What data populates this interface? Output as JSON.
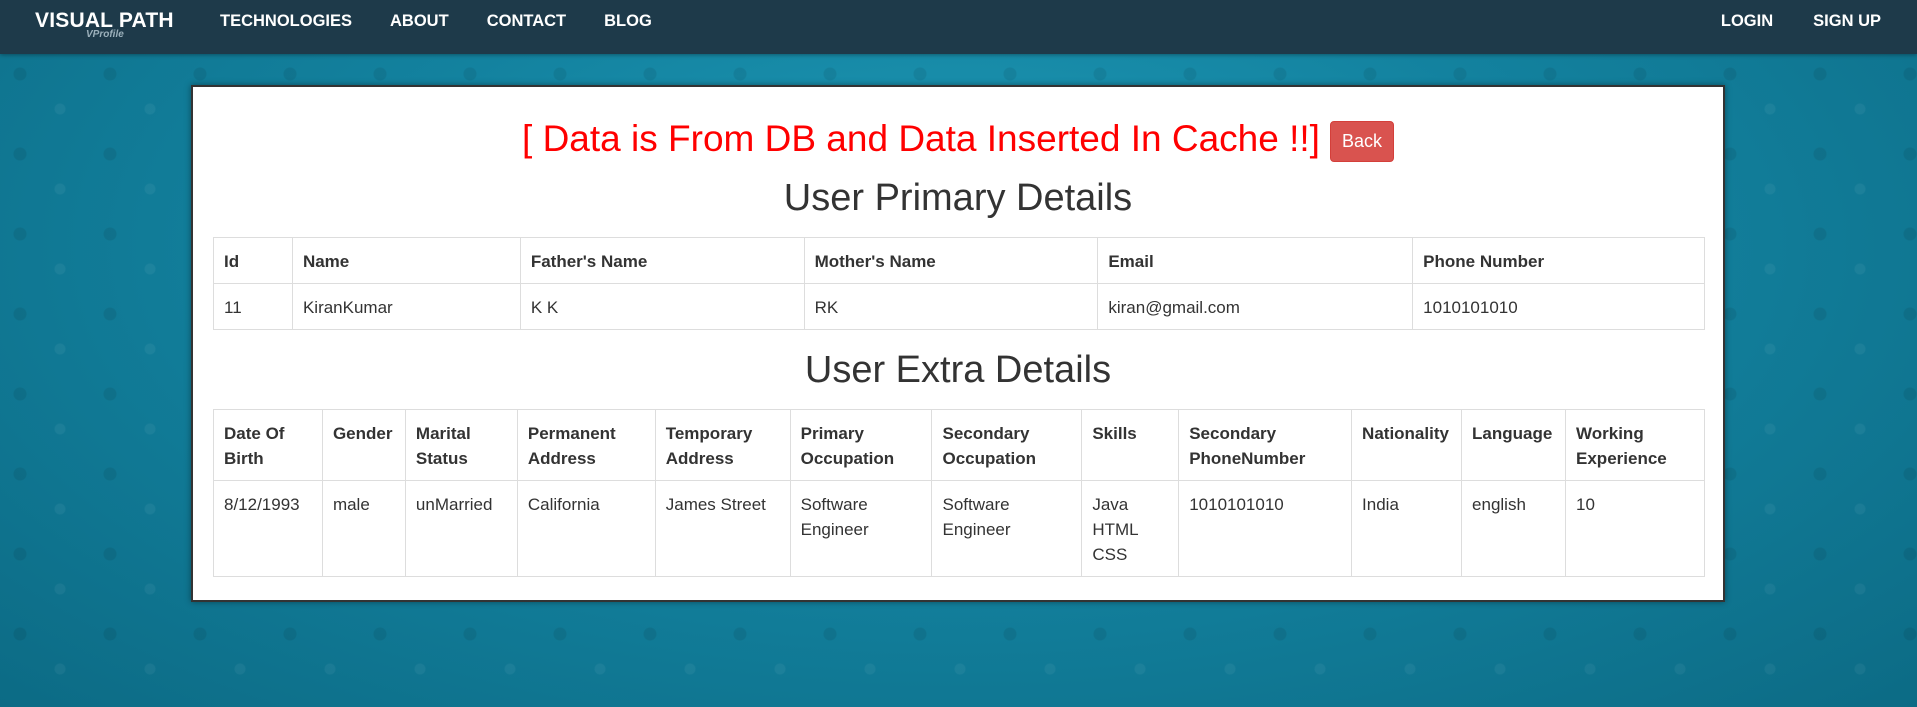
{
  "nav": {
    "brand": "VISUAL PATH",
    "brand_sub": "VProfile",
    "left_links": [
      "TECHNOLOGIES",
      "ABOUT",
      "CONTACT",
      "BLOG"
    ],
    "right_links": [
      "LOGIN",
      "SIGN UP"
    ]
  },
  "banner": {
    "message": "[ Data is From DB and Data Inserted In Cache !!]",
    "back_label": "Back"
  },
  "primary": {
    "title": "User Primary Details",
    "headers": [
      "Id",
      "Name",
      "Father's Name",
      "Mother's Name",
      "Email",
      "Phone Number"
    ],
    "row": [
      "11",
      "KiranKumar",
      "K K",
      "RK",
      "kiran@gmail.com",
      "1010101010"
    ]
  },
  "extra": {
    "title": "User Extra Details",
    "headers": [
      [
        "Date Of",
        "Birth"
      ],
      [
        "Gender"
      ],
      [
        "Marital",
        "Status"
      ],
      [
        "Permanent",
        "Address"
      ],
      [
        "Temporary",
        "Address"
      ],
      [
        "Primary",
        "Occupation"
      ],
      [
        "Secondary",
        "Occupation"
      ],
      [
        "Skills"
      ],
      [
        "Secondary",
        "PhoneNumber"
      ],
      [
        "Nationality"
      ],
      [
        "Language"
      ],
      [
        "Working",
        "Experience"
      ]
    ],
    "row": [
      [
        "8/12/1993"
      ],
      [
        "male"
      ],
      [
        "unMarried"
      ],
      [
        "California"
      ],
      [
        "James Street"
      ],
      [
        "Software",
        "Engineer"
      ],
      [
        "Software",
        "Engineer"
      ],
      [
        "Java",
        "HTML",
        "CSS"
      ],
      [
        "1010101010"
      ],
      [
        "India"
      ],
      [
        "english"
      ],
      [
        "10"
      ]
    ]
  },
  "colors": {
    "navbar": "#1e3a4a",
    "banner_text": "#ff0000",
    "back_button": "#d9534f"
  }
}
